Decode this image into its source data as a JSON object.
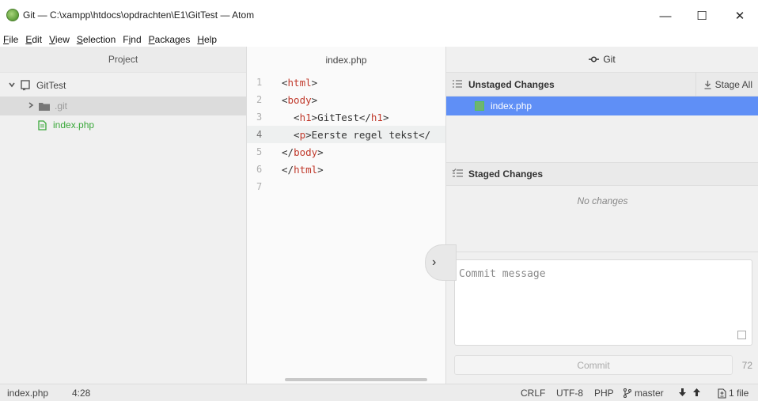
{
  "window": {
    "title": "Git — C:\\xampp\\htdocs\\opdrachten\\E1\\GitTest — Atom",
    "minimize": "—",
    "maximize": "☐",
    "close": "✕"
  },
  "menu": [
    {
      "accel": "F",
      "rest": "ile"
    },
    {
      "accel": "E",
      "rest": "dit"
    },
    {
      "accel": "V",
      "rest": "iew"
    },
    {
      "accel": "S",
      "rest": "election"
    },
    {
      "pre": "F",
      "accel": "i",
      "rest": "nd"
    },
    {
      "accel": "P",
      "rest": "ackages"
    },
    {
      "accel": "H",
      "rest": "elp"
    }
  ],
  "tree": {
    "header": "Project",
    "root": "GitTest",
    "items": [
      {
        "name": ".git",
        "type": "folder"
      },
      {
        "name": "index.php",
        "type": "file"
      }
    ]
  },
  "editor": {
    "tab": "index.php",
    "lines": [
      {
        "num": "1",
        "text": "<html>"
      },
      {
        "num": "2",
        "text": "<body>"
      },
      {
        "num": "3",
        "text": "  <h1>GitTest</h1>"
      },
      {
        "num": "4",
        "text": "  <p>Eerste regel tekst</"
      },
      {
        "num": "5",
        "text": "</body>"
      },
      {
        "num": "6",
        "text": "</html>"
      },
      {
        "num": "7",
        "text": ""
      }
    ],
    "toggle_glyph": "›"
  },
  "git": {
    "header": "Git",
    "unstaged_title": "Unstaged Changes",
    "stage_all": "Stage All",
    "unstaged_files": [
      "index.php"
    ],
    "staged_title": "Staged Changes",
    "staged_empty": "No changes",
    "commit_placeholder": "Commit message",
    "commit_button": "Commit",
    "char_count": "72"
  },
  "statusbar": {
    "file": "index.php",
    "cursor": "4:28",
    "line_ending": "CRLF",
    "encoding": "UTF-8",
    "grammar": "PHP",
    "branch": "master",
    "changes": "1 file"
  },
  "colors": {
    "selection": "#5f8ff6",
    "added_file": "#3aa83a",
    "tag": "#c0392b"
  }
}
